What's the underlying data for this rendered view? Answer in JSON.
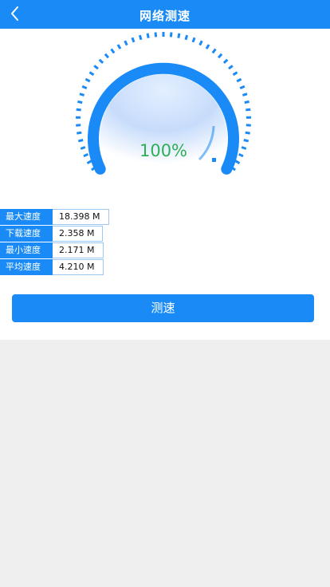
{
  "header": {
    "title": "网络测速",
    "back_icon": "chevron-left-icon"
  },
  "gauge": {
    "percent_text": "100%",
    "accent": "#1a8bf6",
    "percent_color": "#2faf55"
  },
  "stats": [
    {
      "label": "最大速度",
      "value": "18.398 M"
    },
    {
      "label": "下载速度",
      "value": "2.358 M"
    },
    {
      "label": "最小速度",
      "value": "2.171 M"
    },
    {
      "label": "平均速度",
      "value": "4.210 M"
    }
  ],
  "actions": {
    "test_label": "测速"
  }
}
